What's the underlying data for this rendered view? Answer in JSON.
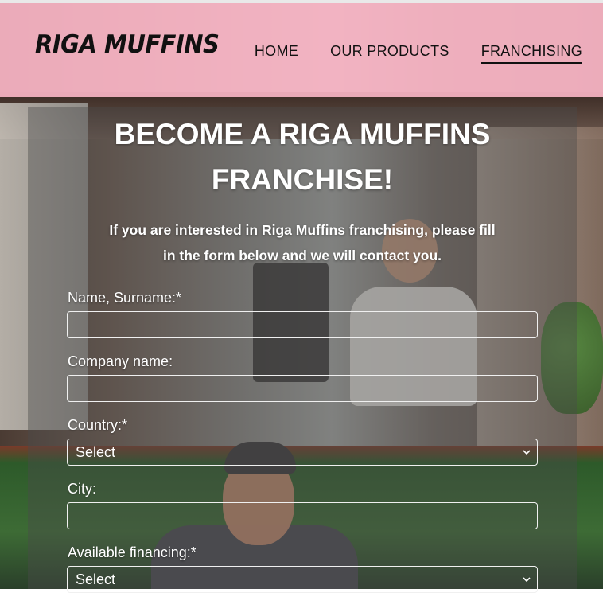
{
  "header": {
    "logo": "RIGA MUFFINS",
    "nav": [
      {
        "label": "HOME"
      },
      {
        "label": "OUR PRODUCTS"
      },
      {
        "label": "FRANCHISING",
        "active": true
      }
    ]
  },
  "main": {
    "title_line1": "BECOME A RIGA MUFFINS",
    "title_line2": "FRANCHISE!",
    "intro_line1": "If you are interested in Riga Muffins franchising, please fill",
    "intro_line2": "in the form below and we will contact you.",
    "form": {
      "name_label": "Name, Surname:*",
      "name_value": "",
      "company_label": "Company name:",
      "company_value": "",
      "country_label": "Country:*",
      "country_selected": "Select",
      "city_label": "City:",
      "city_value": "",
      "financing_label": "Available financing:*",
      "financing_selected": "Select"
    }
  },
  "colors": {
    "header_bg": "#f8b4c4",
    "text_light": "#ffffff",
    "text_dark": "#111111"
  },
  "icons": {
    "select_arrow": "chevron-down-icon"
  }
}
